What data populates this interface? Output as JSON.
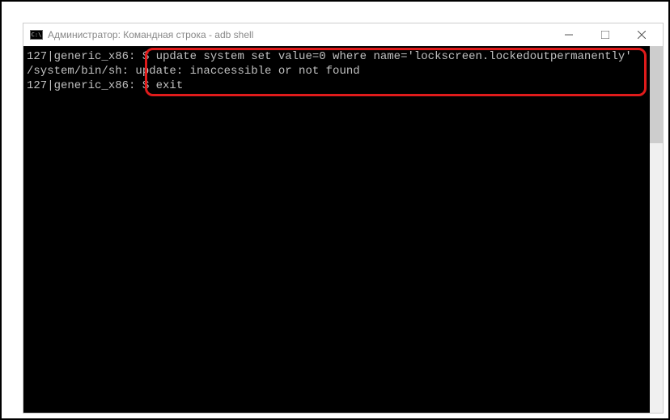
{
  "titlebar": {
    "icon_label": "C:\\",
    "title": "Администратор: Командная строка - adb  shell"
  },
  "window_controls": {
    "minimize": "minimize",
    "maximize": "maximize",
    "close": "close"
  },
  "terminal": {
    "lines": [
      {
        "prompt": "127|generic_x86:",
        "text": " $ update system set value=0 where name='lockscreen.lockedoutpermanently'"
      },
      {
        "prompt": "/system/bin/sh: ",
        "text": "update: inaccessible or not found"
      },
      {
        "prompt": "127|generic_x86:",
        "text": " $ exit"
      }
    ]
  },
  "annotation": {
    "highlight_color": "#e01b1b"
  }
}
